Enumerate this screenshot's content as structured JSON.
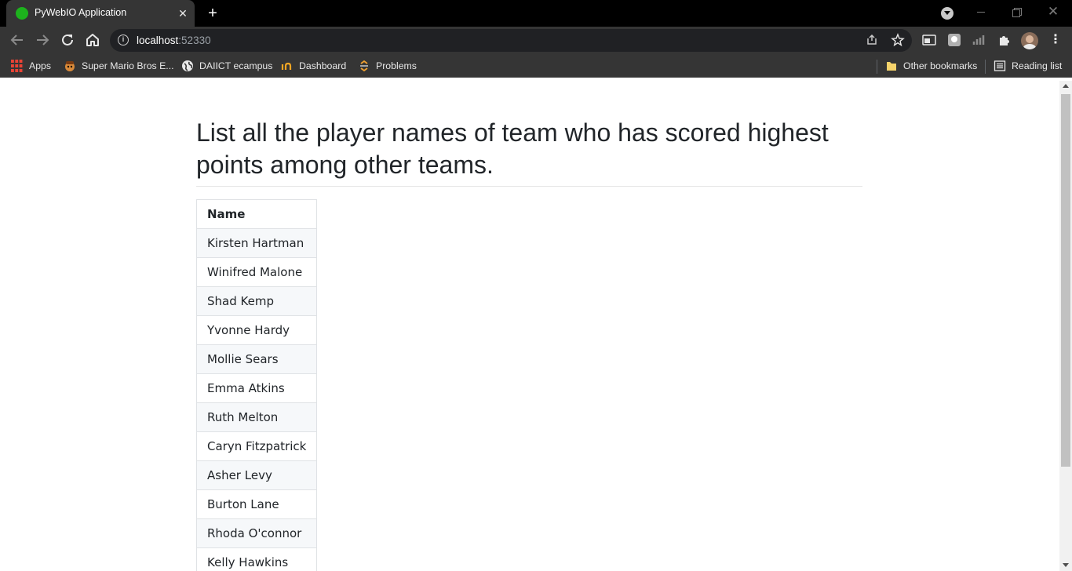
{
  "browser": {
    "tab_title": "PyWebIO Application",
    "url_host": "localhost",
    "url_port": ":52330",
    "bookmarks": [
      {
        "label": "Apps",
        "icon": "apps-grid-icon"
      },
      {
        "label": "Super Mario Bros E...",
        "icon": "mario-icon"
      },
      {
        "label": "DAIICT ecampus",
        "icon": "globe-icon"
      },
      {
        "label": "Dashboard",
        "icon": "dashboard-icon"
      },
      {
        "label": "Problems",
        "icon": "problems-icon"
      }
    ],
    "other_bookmarks": "Other bookmarks",
    "reading_list": "Reading list"
  },
  "page": {
    "heading": "List all the player names of team who has scored highest points among other teams.",
    "table": {
      "header": "Name",
      "rows": [
        "Kirsten Hartman",
        "Winifred Malone",
        "Shad Kemp",
        "Yvonne Hardy",
        "Mollie Sears",
        "Emma Atkins",
        "Ruth Melton",
        "Caryn Fitzpatrick",
        "Asher Levy",
        "Burton Lane",
        "Rhoda O'connor",
        "Kelly Hawkins"
      ]
    }
  },
  "colors": {
    "chrome_dark": "#353535",
    "tabbar": "#000000",
    "text_dark": "#212529",
    "row_stripe": "#f6f8fa",
    "favicon": "#1db21d"
  }
}
